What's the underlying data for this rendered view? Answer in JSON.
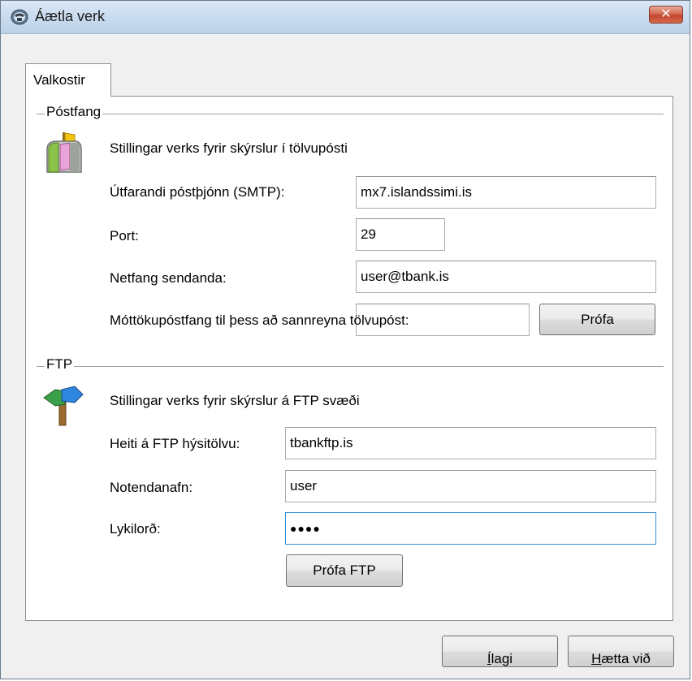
{
  "window": {
    "title": "Áætla verk",
    "close_label": "✕"
  },
  "tabs": [
    {
      "label": "Valkostir",
      "selected": true
    }
  ],
  "email": {
    "group_title": "Póstfang",
    "description": "Stillingar verks fyrir skýrslur í tölvupósti",
    "smtp_label": "Útfarandi póstþjónn (SMTP):",
    "smtp_value": "mx7.islandssimi.is",
    "port_label": "Port:",
    "port_value": "29",
    "sender_label": "Netfang sendanda:",
    "sender_value": "user@tbank.is",
    "verify_label": "Móttökupóstfang til þess að sannreyna tölvupóst:",
    "verify_value": "",
    "test_button": "Prófa"
  },
  "ftp": {
    "group_title": "FTP",
    "description": "Stillingar verks fyrir skýrslur á FTP svæði",
    "host_label": "Heiti á FTP hýsitölvu:",
    "host_value": "tbankftp.is",
    "user_label": "Notendanafn:",
    "user_value": "user",
    "password_label": "Lykilorð:",
    "password_value": "●●●●",
    "test_button": "Prófa FTP"
  },
  "footer": {
    "ok_first": "Í",
    "ok_rest": "lagi",
    "cancel_first": "H",
    "cancel_rest": "ætta við"
  },
  "colors": {
    "accent_focus": "#3a8fd6",
    "close_button": "#c3442c"
  }
}
